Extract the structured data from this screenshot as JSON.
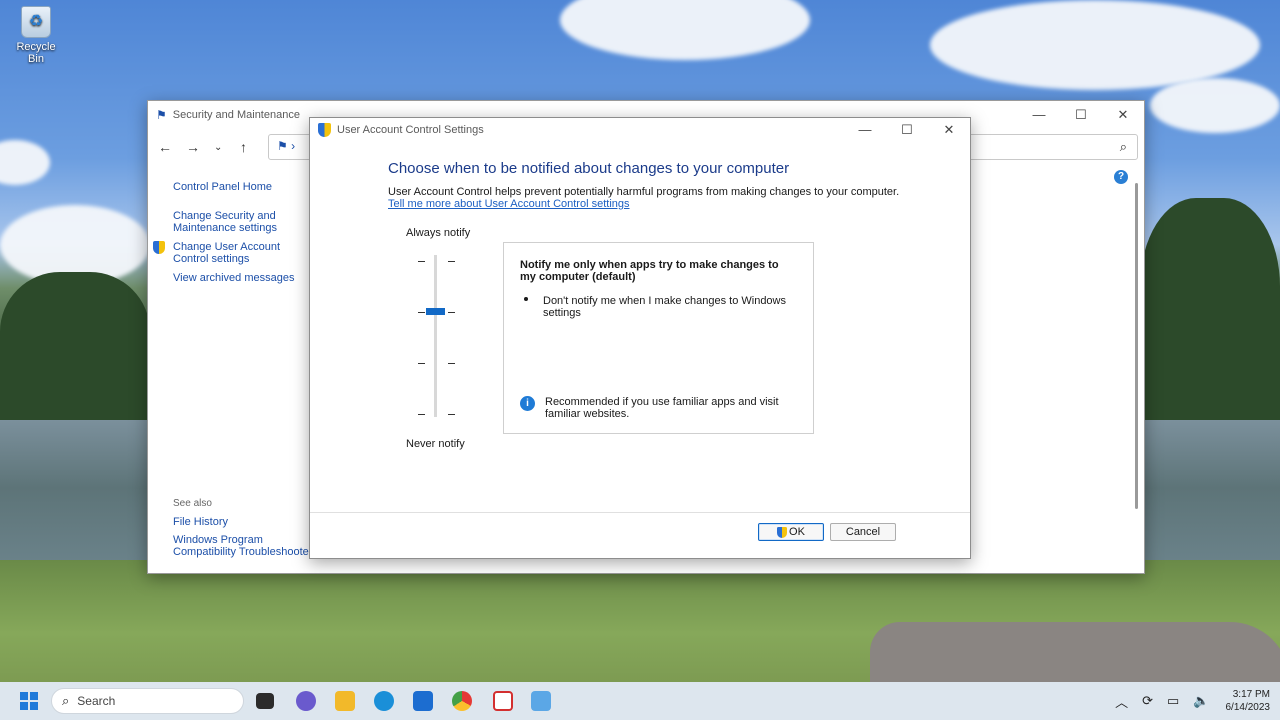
{
  "desktop": {
    "recycle_bin_label": "Recycle Bin"
  },
  "security_window": {
    "title": "Security and Maintenance",
    "address_sep": "›",
    "sidebar": {
      "home": "Control Panel Home",
      "links": [
        "Change Security and Maintenance settings",
        "Change User Account Control settings",
        "View archived messages"
      ]
    },
    "see_also": {
      "heading": "See also",
      "links": [
        "File History",
        "Windows Program Compatibility Troubleshooter"
      ]
    }
  },
  "uac_dialog": {
    "title": "User Account Control Settings",
    "heading": "Choose when to be notified about changes to your computer",
    "description": "User Account Control helps prevent potentially harmful programs from making changes to your computer.",
    "learn_more_link": "Tell me more about User Account Control settings",
    "slider_top_label": "Always notify",
    "slider_bottom_label": "Never notify",
    "slider_level": {
      "selected_step": 2,
      "total_steps": 4
    },
    "info_title": "Notify me only when apps try to make changes to my computer (default)",
    "info_bullet": "Don't notify me when I make changes to Windows settings",
    "info_recommendation": "Recommended if you use familiar apps and visit familiar websites.",
    "ok_label": "OK",
    "cancel_label": "Cancel"
  },
  "taskbar": {
    "search_placeholder": "Search",
    "time": "3:17 PM",
    "date": "6/14/2023"
  }
}
